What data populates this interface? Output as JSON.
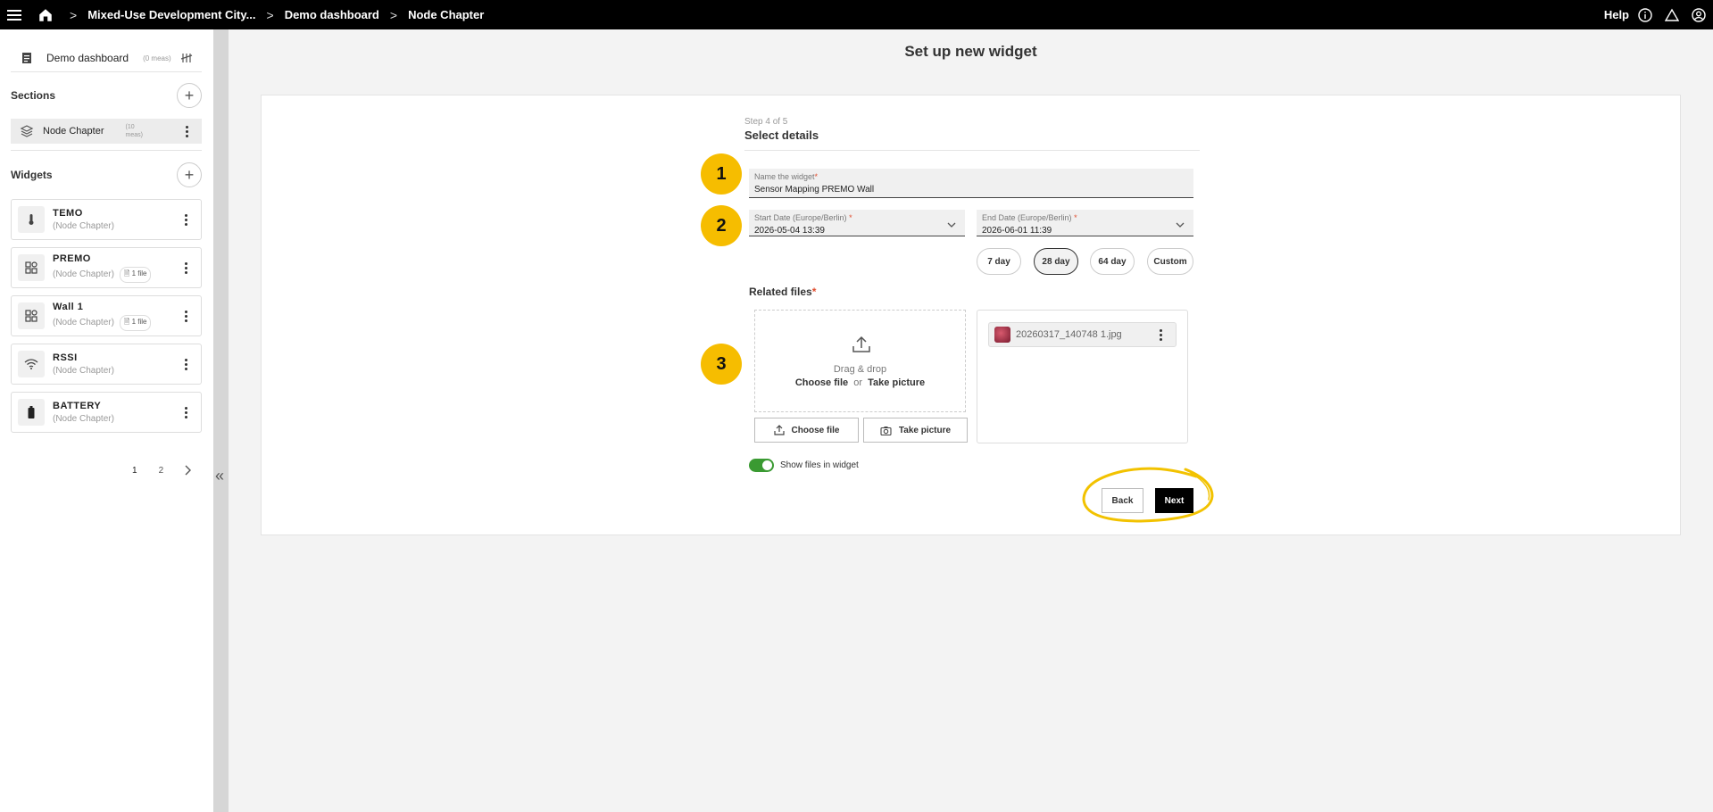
{
  "topbar": {
    "breadcrumbs": [
      "Mixed-Use Development City...",
      "Demo dashboard",
      "Node Chapter"
    ],
    "help_label": "Help",
    "icons": [
      "hamburger-menu-icon",
      "home-icon",
      "info-icon",
      "alert-icon",
      "user-icon"
    ]
  },
  "sidebar": {
    "dashboard": {
      "name": "Demo dashboard",
      "meas": "(0 meas)"
    },
    "sections_label": "Sections",
    "section_item": {
      "name": "Node Chapter",
      "meas": "(10 meas)"
    },
    "widgets_label": "Widgets",
    "widgets": [
      {
        "title": "TEMO",
        "sub": "(Node Chapter)",
        "badge": "",
        "icon": "thermometer-icon"
      },
      {
        "title": "PREMO",
        "sub": "(Node Chapter)",
        "badge": "1 file",
        "icon": "grid-icon"
      },
      {
        "title": "Wall 1",
        "sub": "(Node Chapter)",
        "badge": "1 file",
        "icon": "grid-icon"
      },
      {
        "title": "RSSI",
        "sub": "(Node Chapter)",
        "badge": "",
        "icon": "wifi-icon"
      },
      {
        "title": "BATTERY",
        "sub": "(Node Chapter)",
        "badge": "",
        "icon": "battery-icon"
      }
    ],
    "pager": {
      "pages": [
        "1",
        "2"
      ],
      "current": "1"
    }
  },
  "main": {
    "page_title": "Set up new widget",
    "step": "Step 4 of 5",
    "step_name": "Select details",
    "markers": [
      "1",
      "2",
      "3"
    ],
    "name_field": {
      "label": "Name the widget",
      "value": "Sensor Mapping PREMO Wall"
    },
    "start_date": {
      "label": "Start Date (Europe/Berlin)",
      "value": "2026-05-04 13:39"
    },
    "end_date": {
      "label": "End Date (Europe/Berlin)",
      "value": "2026-06-01 11:39"
    },
    "required_mark": "*",
    "ranges": [
      "7 day",
      "28 day",
      "64 day",
      "Custom"
    ],
    "selected_range": "28 day",
    "related_files_label": "Related files",
    "drop": {
      "line1": "Drag & drop",
      "choose": "Choose file",
      "or": "or",
      "take": "Take picture"
    },
    "buttons": {
      "choose_file": "Choose file",
      "take_picture": "Take picture",
      "back": "Back",
      "next": "Next"
    },
    "file": {
      "name": "20260317_140748 1.jpg"
    },
    "toggle": {
      "label": "Show files in widget",
      "on": true
    },
    "colors": {
      "marker": "#f6bd00",
      "toggle": "#3a9a32",
      "required": "#e04d2f"
    }
  }
}
